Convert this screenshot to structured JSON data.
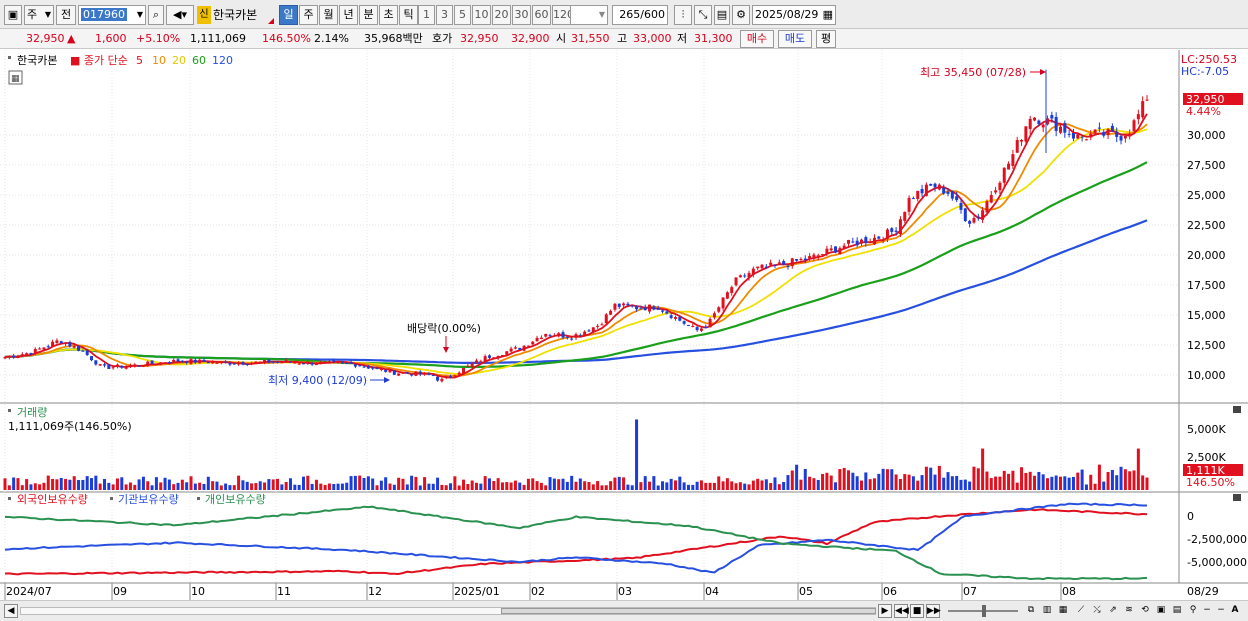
{
  "toolbar": {
    "market": "주",
    "prev": "전",
    "code": "017960",
    "new_badge": "신",
    "stock_name": "한국카본",
    "periods": [
      "일",
      "주",
      "월",
      "년",
      "분",
      "초",
      "틱"
    ],
    "selected_period": "일",
    "intervals": [
      "1",
      "3",
      "5",
      "10",
      "20",
      "30",
      "60",
      "120"
    ],
    "count_value": "265",
    "count_total": "/600",
    "date": "2025/08/29"
  },
  "quote": {
    "price": "32,950",
    "change_arrow": "▲",
    "change": "1,600",
    "change_pct": "+5.10%",
    "volume": "1,111,069",
    "volume_ratio": "146.50%",
    "turnover": "2.14%",
    "trade_value": "35,968백만",
    "bid_label": "호가",
    "ask_price": "32,950",
    "bid_price": "32,900",
    "open_label": "시",
    "open": "31,550",
    "high_label": "고",
    "high": "33,000",
    "low_label": "저",
    "low": "31,300",
    "buy_label": "매수",
    "sell_label": "매도",
    "eval_label": "평"
  },
  "price_panel": {
    "legend_name": "한국카본",
    "legend_ma_label": "종가 단순",
    "ma_periods": [
      "5",
      "10",
      "20",
      "60",
      "120"
    ],
    "lc_label": "LC:250.53",
    "hc_label": "HC:-7.05",
    "high_annotation": "최고 35,450 (07/28)",
    "low_annotation": "최저 9,400 (12/09)",
    "dividend_annotation": "배당락(0.00%)",
    "current_price_tag": "32,950",
    "current_pct_tag": "4.44%",
    "y_ticks": [
      "30,000",
      "27,500",
      "25,000",
      "22,500",
      "20,000",
      "17,500",
      "15,000",
      "12,500",
      "10,000"
    ]
  },
  "volume_panel": {
    "title": "거래량",
    "value_label": "1,111,069주(146.50%)",
    "y_ticks": [
      "5,000K",
      "2,500K"
    ],
    "current_tag": "1,111K",
    "ratio_tag": "146.50%"
  },
  "holding_panel": {
    "legends": [
      "외국인보유수량",
      "기관보유수량",
      "개인보유수량"
    ],
    "y_ticks": [
      "0",
      "-2,500,000",
      "-5,000,000"
    ]
  },
  "x_axis": {
    "labels": [
      "2024/07",
      "09",
      "10",
      "11",
      "12",
      "2025/01",
      "02",
      "03",
      "04",
      "05",
      "06",
      "07",
      "08"
    ],
    "right_label": "08/29"
  },
  "colors": {
    "up": "#e0101e",
    "down": "#1a3cd8",
    "ma5": "#e0101e",
    "ma10": "#f08a00",
    "ma20": "#f0e000",
    "ma60": "#1aa01a",
    "ma120": "#2850e0",
    "foreign": "#e0101e",
    "institution": "#2850e0",
    "individual": "#2a9050"
  }
}
